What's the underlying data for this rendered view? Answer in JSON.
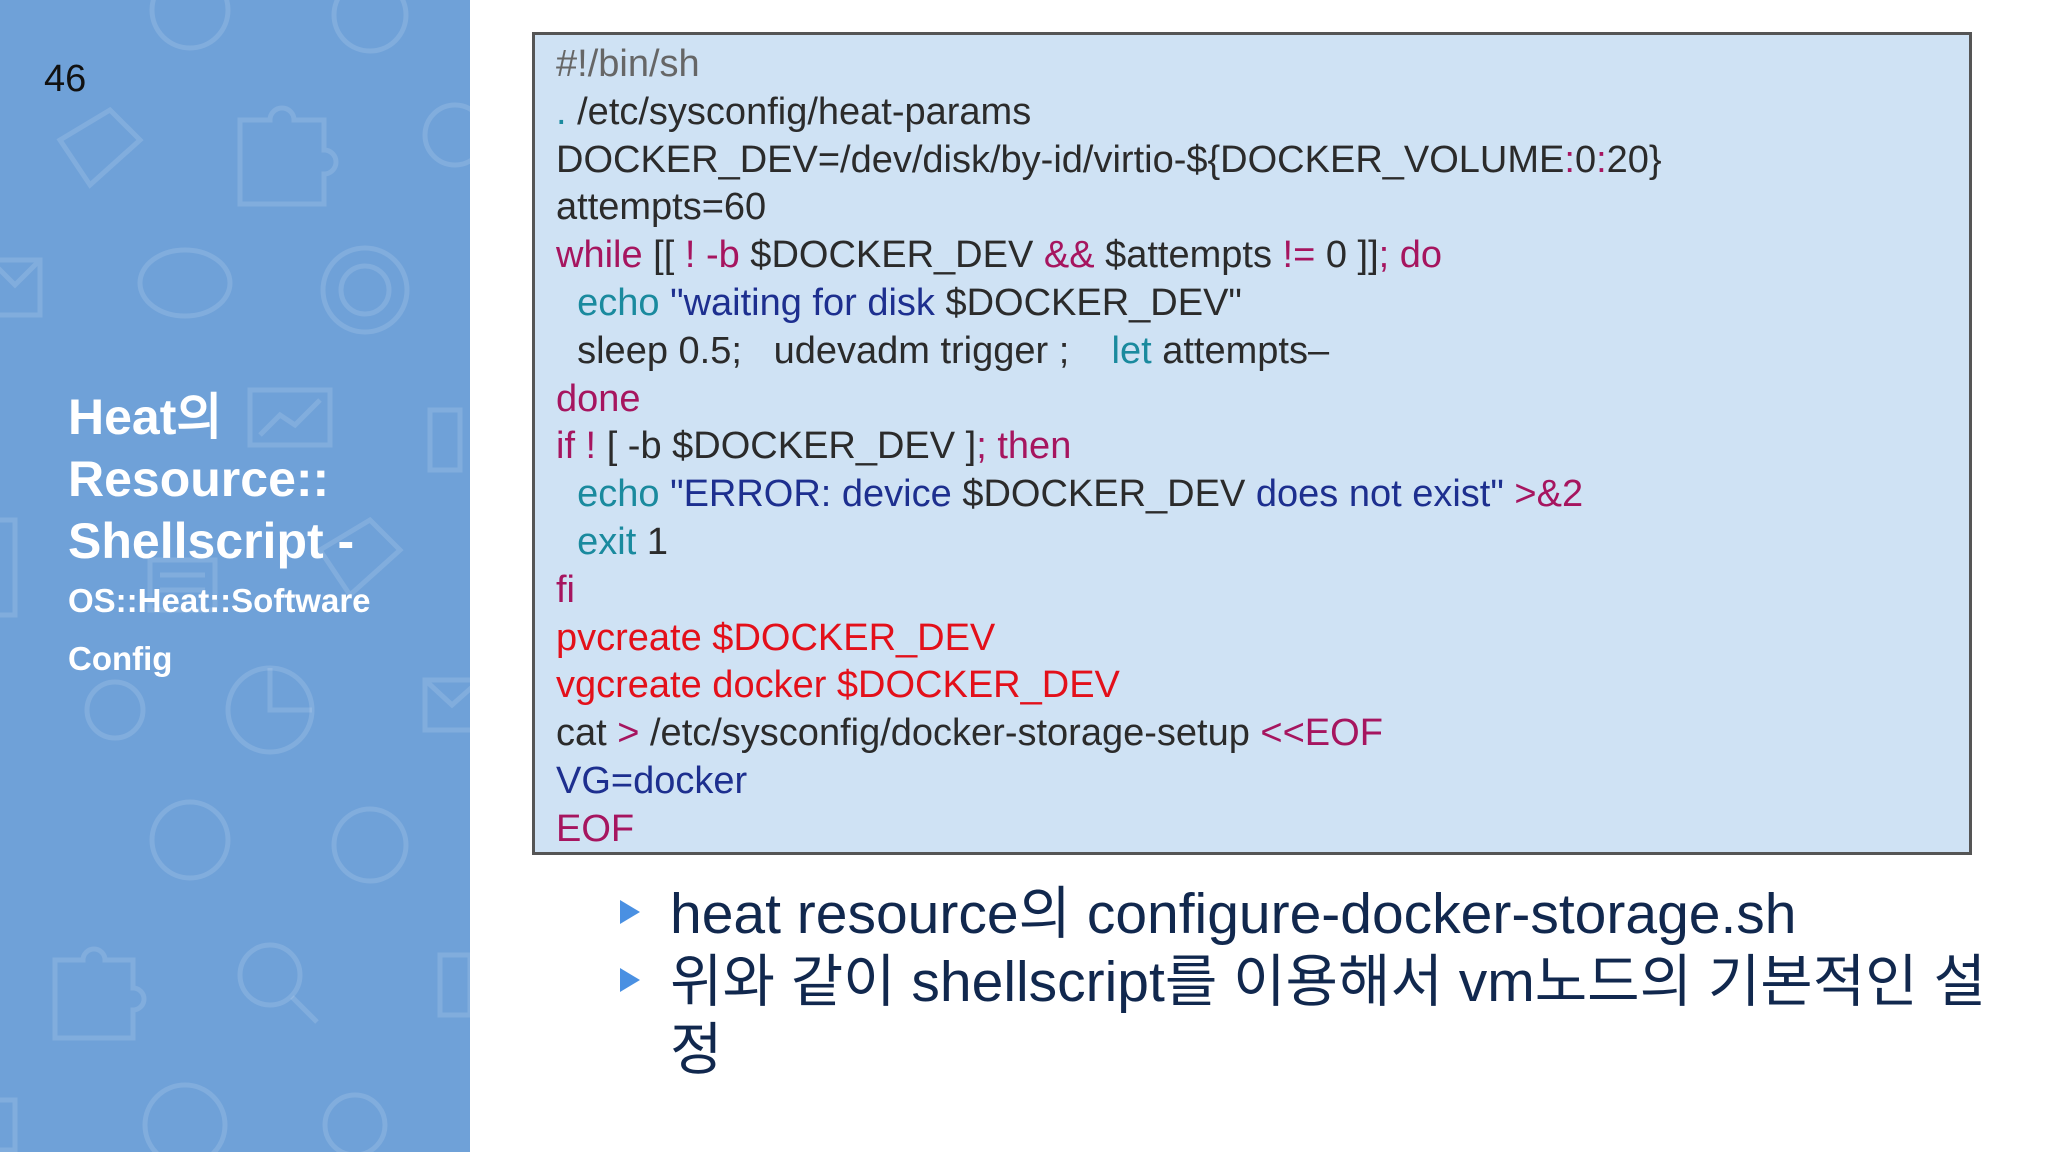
{
  "slide_number": "46",
  "sidebar": {
    "title_big": "Heat의 Resource:: Shellscript -",
    "title_small": "OS::Heat::Software Config",
    "bg_color": "#6fa1d8"
  },
  "code": {
    "lines": [
      [
        {
          "t": "#!/bin/sh",
          "c": "comment"
        }
      ],
      [
        {
          "t": ". ",
          "c": "builtin"
        },
        {
          "t": "/etc/sysconfig/heat-params",
          "c": "default"
        }
      ],
      [
        {
          "t": "DOCKER_DEV=/dev/disk/by-id/virtio-${DOCKER_VOLUME",
          "c": "default"
        },
        {
          "t": ":",
          "c": "keyword"
        },
        {
          "t": "0",
          "c": "default"
        },
        {
          "t": ":",
          "c": "keyword"
        },
        {
          "t": "20}",
          "c": "default"
        }
      ],
      [
        {
          "t": "attempts=60",
          "c": "default"
        }
      ],
      [
        {
          "t": "while ",
          "c": "keyword"
        },
        {
          "t": "[[ ",
          "c": "default"
        },
        {
          "t": "! -b",
          "c": "keyword"
        },
        {
          "t": " $DOCKER_DEV ",
          "c": "default"
        },
        {
          "t": "&&",
          "c": "keyword"
        },
        {
          "t": " $attempts ",
          "c": "default"
        },
        {
          "t": "!=",
          "c": "keyword"
        },
        {
          "t": " 0 ]]",
          "c": "default"
        },
        {
          "t": "; do",
          "c": "keyword"
        }
      ],
      [
        {
          "t": "  echo ",
          "c": "builtin"
        },
        {
          "t": "\"waiting for disk ",
          "c": "string"
        },
        {
          "t": "$DOCKER_DEV\"",
          "c": "default"
        }
      ],
      [
        {
          "t": "  sleep 0.5;   udevadm trigger ;    ",
          "c": "default"
        },
        {
          "t": "let ",
          "c": "builtin"
        },
        {
          "t": "attempts–",
          "c": "default"
        }
      ],
      [
        {
          "t": "done",
          "c": "keyword"
        }
      ],
      [
        {
          "t": "if ! ",
          "c": "keyword"
        },
        {
          "t": "[ -b $DOCKER_DEV ]",
          "c": "default"
        },
        {
          "t": "; then",
          "c": "keyword"
        }
      ],
      [
        {
          "t": "  echo ",
          "c": "builtin"
        },
        {
          "t": "\"ERROR: device ",
          "c": "string"
        },
        {
          "t": "$DOCKER_DEV ",
          "c": "default"
        },
        {
          "t": "does not exist\" ",
          "c": "string"
        },
        {
          "t": ">&2",
          "c": "keyword"
        }
      ],
      [
        {
          "t": "  exit ",
          "c": "builtin"
        },
        {
          "t": "1",
          "c": "default"
        }
      ],
      [
        {
          "t": "fi",
          "c": "keyword"
        }
      ],
      [
        {
          "t": "pvcreate $DOCKER_DEV",
          "c": "red"
        }
      ],
      [
        {
          "t": "vgcreate docker $DOCKER_DEV",
          "c": "red"
        }
      ],
      [
        {
          "t": "cat ",
          "c": "default"
        },
        {
          "t": "> ",
          "c": "keyword"
        },
        {
          "t": "/etc/sysconfig/docker-storage-setup ",
          "c": "default"
        },
        {
          "t": "<<EOF",
          "c": "keyword"
        }
      ],
      [
        {
          "t": "VG=docker",
          "c": "blue"
        }
      ],
      [
        {
          "t": "EOF",
          "c": "keyword"
        }
      ]
    ]
  },
  "bullets": [
    "heat resource의 configure-docker-storage.sh",
    "위와 같이 shellscript를 이용해서 vm노드의 기본적인 설정"
  ],
  "colors": {
    "code_background": "#cfe2f4",
    "bullet_text": "#11284e",
    "bullet_arrow": "#4a90e2"
  }
}
